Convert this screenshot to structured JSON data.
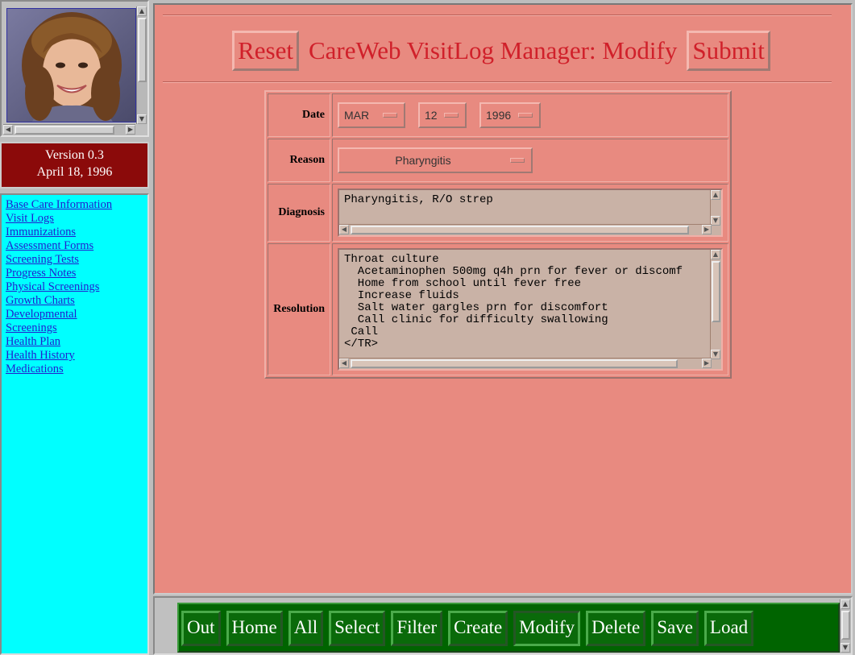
{
  "sidebar": {
    "version": "Version 0.3",
    "date": "April 18, 1996",
    "links": [
      "Base Care Information",
      "Visit Logs",
      "Immunizations",
      "Assessment Forms",
      "Screening Tests",
      "Progress Notes",
      "Physical Screenings",
      "Growth Charts",
      "Developmental",
      "Screenings",
      "Health Plan",
      "Health History",
      "Medications"
    ]
  },
  "header": {
    "reset_label": "Reset",
    "title": "CareWeb VisitLog Manager: Modify",
    "submit_label": "Submit"
  },
  "form": {
    "date": {
      "label": "Date",
      "month": "MAR",
      "day": "12",
      "year": "1996"
    },
    "reason": {
      "label": "Reason",
      "value": "Pharyngitis"
    },
    "diagnosis": {
      "label": "Diagnosis",
      "value": "Pharyngitis, R/O strep"
    },
    "resolution": {
      "label": "Resolution",
      "value": "Throat culture\n  Acetaminophen 500mg q4h prn for fever or discomf\n  Home from school until fever free\n  Increase fluids\n  Salt water gargles prn for discomfort\n  Call clinic for difficulty swallowing\n Call\n</TR>"
    }
  },
  "toolbar": {
    "buttons": [
      "Out",
      "Home",
      "All",
      "Select",
      "Filter",
      "Create",
      "Modify",
      "Delete",
      "Save",
      "Load"
    ]
  },
  "colors": {
    "main_bg": "#e88a80",
    "title_red": "#d0202a",
    "nav_bg": "#00ffff",
    "version_bg": "#8b0a0a",
    "toolbar_bg": "#006400"
  }
}
